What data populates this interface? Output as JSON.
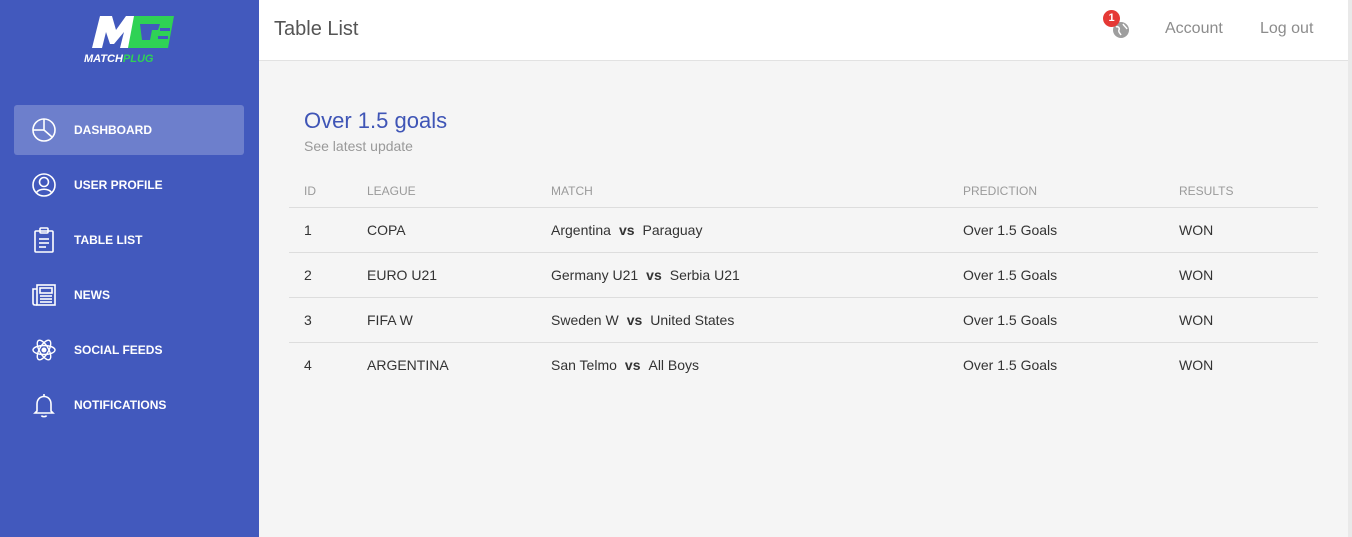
{
  "brand": {
    "logo_text_main": "MATCH",
    "logo_text_accent": "PLUG"
  },
  "sidebar": {
    "items": [
      {
        "label": "DASHBOARD",
        "icon": "pie-chart-icon",
        "active": true
      },
      {
        "label": "USER PROFILE",
        "icon": "user-icon",
        "active": false
      },
      {
        "label": "TABLE LIST",
        "icon": "clipboard-icon",
        "active": false
      },
      {
        "label": "NEWS",
        "icon": "newspaper-icon",
        "active": false
      },
      {
        "label": "SOCIAL FEEDS",
        "icon": "atom-icon",
        "active": false
      },
      {
        "label": "NOTIFICATIONS",
        "icon": "bell-icon",
        "active": false
      }
    ]
  },
  "header": {
    "title": "Table List",
    "notification_count": "1",
    "account_label": "Account",
    "logout_label": "Log out"
  },
  "card": {
    "title": "Over 1.5 goals",
    "subtitle": "See latest update"
  },
  "table": {
    "columns": [
      "ID",
      "LEAGUE",
      "MATCH",
      "PREDICTION",
      "RESULTS"
    ],
    "vs_label": "vs",
    "rows": [
      {
        "id": "1",
        "league": "COPA",
        "home": "Argentina",
        "away": "Paraguay",
        "prediction": "Over 1.5 Goals",
        "result": "WON"
      },
      {
        "id": "2",
        "league": "EURO U21",
        "home": "Germany U21",
        "away": "Serbia U21",
        "prediction": "Over 1.5 Goals",
        "result": "WON"
      },
      {
        "id": "3",
        "league": "FIFA W",
        "home": "Sweden W",
        "away": "United States",
        "prediction": "Over 1.5 Goals",
        "result": "WON"
      },
      {
        "id": "4",
        "league": "ARGENTINA",
        "home": "San Telmo",
        "away": "All Boys",
        "prediction": "Over 1.5 Goals",
        "result": "WON"
      }
    ]
  },
  "colors": {
    "sidebar": "#4259bd",
    "accent": "#3f55b6",
    "logo_green": "#2fd255",
    "badge": "#e53935"
  }
}
